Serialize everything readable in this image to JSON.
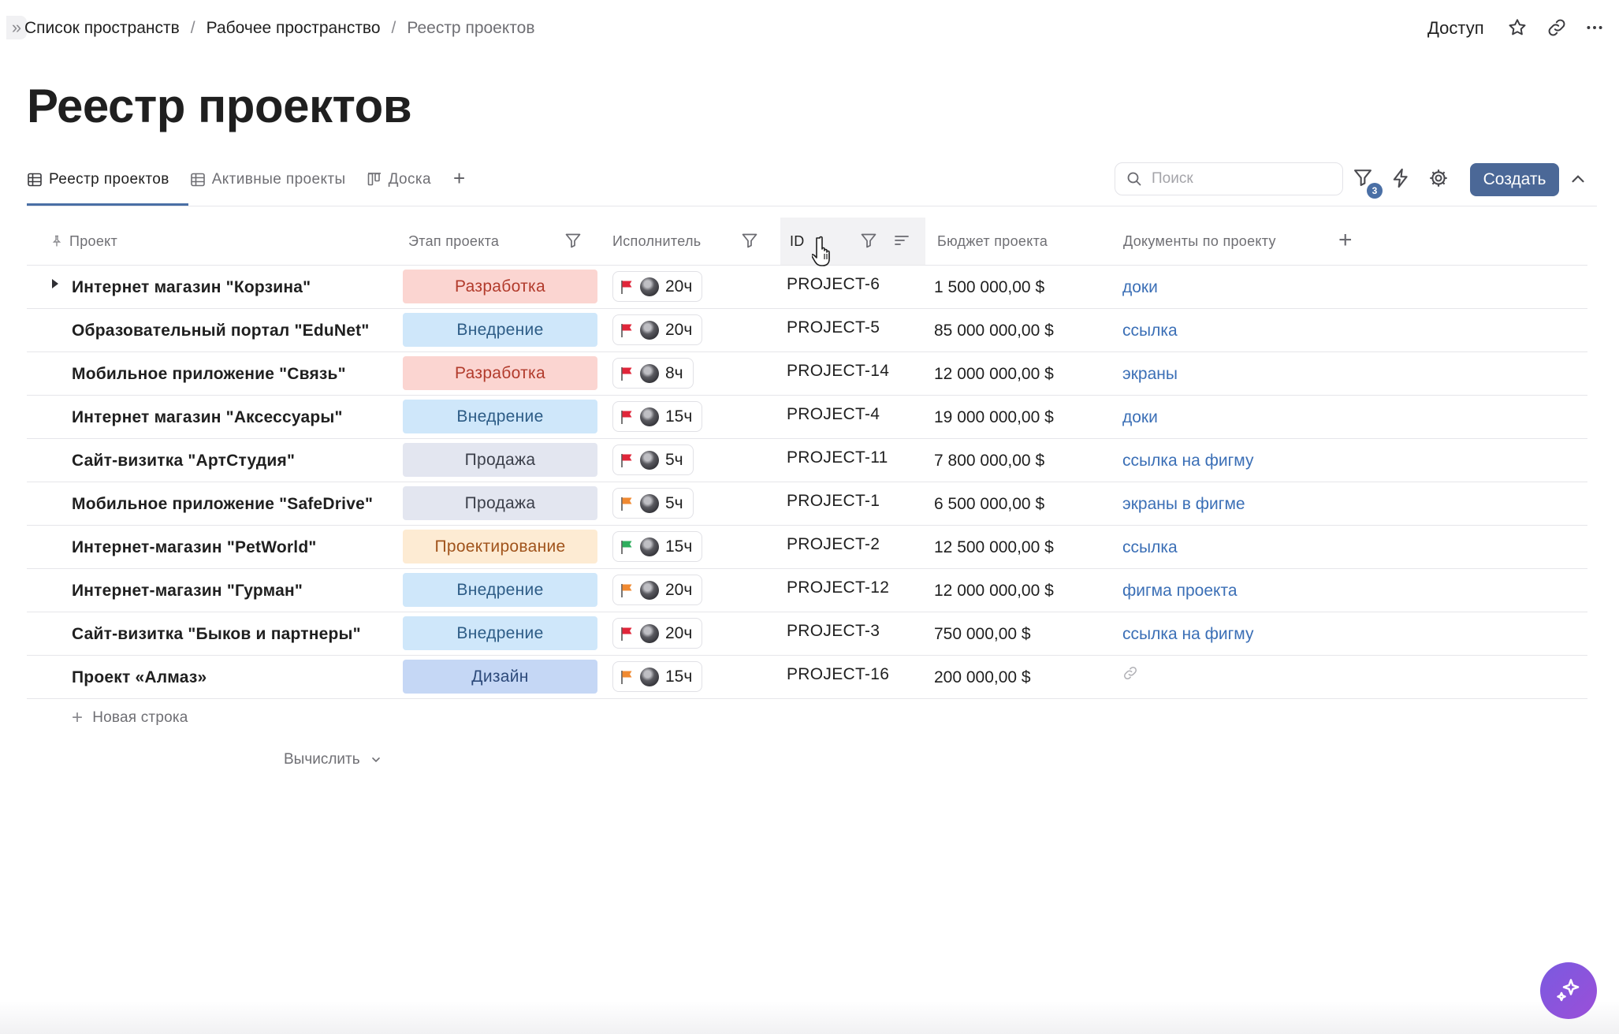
{
  "breadcrumbs": [
    "Список пространств",
    "Рабочее пространство",
    "Реестр проектов"
  ],
  "header": {
    "access_label": "Доступ",
    "title": "Реестр проектов"
  },
  "tabs": [
    {
      "label": "Реестр проектов",
      "icon": "table-icon",
      "active": true
    },
    {
      "label": "Активные проекты",
      "icon": "table-icon",
      "active": false
    },
    {
      "label": "Доска",
      "icon": "board-icon",
      "active": false
    }
  ],
  "toolbar": {
    "search_placeholder": "Поиск",
    "filter_count": "3",
    "create_label": "Создать"
  },
  "columns": {
    "project": "Проект",
    "stage": "Этап проекта",
    "executor": "Исполнитель",
    "id": "ID",
    "budget": "Бюджет проекта",
    "docs": "Документы по проекту"
  },
  "colors": {
    "accent": "#4a6fa5",
    "link": "#3b6fb6",
    "flag_red": "#e0263a",
    "flag_orange": "#f08a32",
    "flag_green": "#2fae5e"
  },
  "rows": [
    {
      "name": "Интернет магазин \"Корзина\"",
      "stage": "Разработка",
      "stage_bg": "#fbd5d1",
      "stage_fg": "#b23b2c",
      "flag": "#e0263a",
      "hours": "20ч",
      "id": "PROJECT-6",
      "budget": "1 500 000,00 $",
      "doc": "доки",
      "expandable": true
    },
    {
      "name": "Образовательный портал \"EduNet\"",
      "stage": "Внедрение",
      "stage_bg": "#cfe7fa",
      "stage_fg": "#2d5c86",
      "flag": "#e0263a",
      "hours": "20ч",
      "id": "PROJECT-5",
      "budget": "85 000 000,00 $",
      "doc": "ссылка"
    },
    {
      "name": "Мобильное приложение \"Связь\"",
      "stage": "Разработка",
      "stage_bg": "#fbd5d1",
      "stage_fg": "#b23b2c",
      "flag": "#e0263a",
      "hours": "8ч",
      "id": "PROJECT-14",
      "budget": "12 000 000,00 $",
      "doc": "экраны"
    },
    {
      "name": "Интернет магазин \"Аксессуары\"",
      "stage": "Внедрение",
      "stage_bg": "#cfe7fa",
      "stage_fg": "#2d5c86",
      "flag": "#e0263a",
      "hours": "15ч",
      "id": "PROJECT-4",
      "budget": "19 000 000,00 $",
      "doc": "доки"
    },
    {
      "name": "Сайт-визитка \"АртСтудия\"",
      "stage": "Продажа",
      "stage_bg": "#e3e6f0",
      "stage_fg": "#3b3f4a",
      "flag": "#e0263a",
      "hours": "5ч",
      "id": "PROJECT-11",
      "budget": "7 800 000,00 $",
      "doc": "ссылка на фигму"
    },
    {
      "name": "Мобильное приложение \"SafeDrive\"",
      "stage": "Продажа",
      "stage_bg": "#e3e6f0",
      "stage_fg": "#3b3f4a",
      "flag": "#f08a32",
      "hours": "5ч",
      "id": "PROJECT-1",
      "budget": "6 500 000,00 $",
      "doc": "экраны в фигме"
    },
    {
      "name": "Интернет-магазин \"PetWorld\"",
      "stage": "Проектирование",
      "stage_bg": "#fdebd3",
      "stage_fg": "#a0531b",
      "flag": "#2fae5e",
      "hours": "15ч",
      "id": "PROJECT-2",
      "budget": "12 500 000,00 $",
      "doc": "ссылка"
    },
    {
      "name": "Интернет-магазин \"Гурман\"",
      "stage": "Внедрение",
      "stage_bg": "#cfe7fa",
      "stage_fg": "#2d5c86",
      "flag": "#f08a32",
      "hours": "20ч",
      "id": "PROJECT-12",
      "budget": "12 000 000,00 $",
      "doc": "фигма проекта"
    },
    {
      "name": "Сайт-визитка \"Быков и партнеры\"",
      "stage": "Внедрение",
      "stage_bg": "#cfe7fa",
      "stage_fg": "#2d5c86",
      "flag": "#e0263a",
      "hours": "20ч",
      "id": "PROJECT-3",
      "budget": "750 000,00 $",
      "doc": "ссылка на фигму"
    },
    {
      "name": "Проект «Алмаз»",
      "stage": "Дизайн",
      "stage_bg": "#c5d7f5",
      "stage_fg": "#2d4a7a",
      "flag": "#f08a32",
      "hours": "15ч",
      "id": "PROJECT-16",
      "budget": "200 000,00 $",
      "doc": "",
      "doc_icon": "link-icon"
    }
  ],
  "footer": {
    "new_row_label": "Новая строка",
    "calc_label": "Вычислить"
  }
}
